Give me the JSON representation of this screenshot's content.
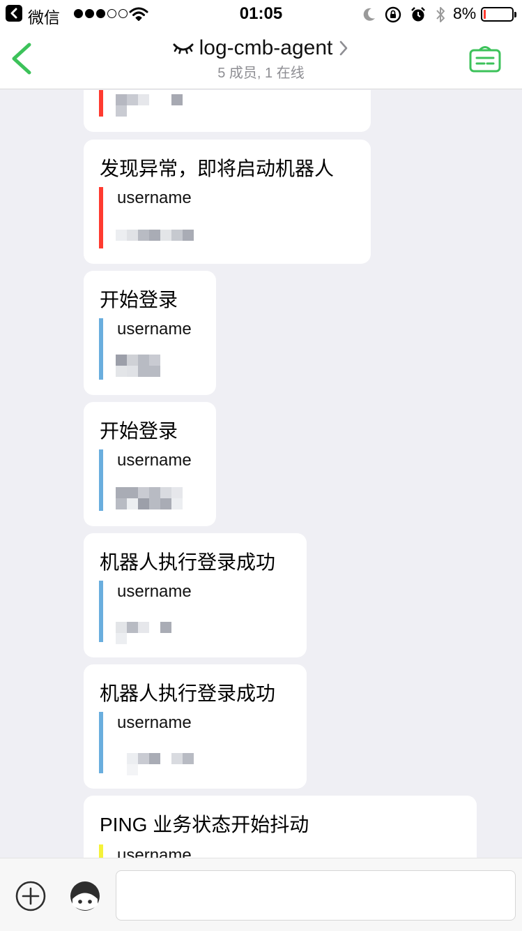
{
  "status_bar": {
    "carrier": "微信",
    "time": "01:05",
    "battery": "8%",
    "battery_level_percent": 8
  },
  "nav": {
    "title": "log-cmb-agent",
    "subtitle": "5 成员, 1 在线",
    "accent_color": "#3cc25a"
  },
  "messages": [
    {
      "title": "",
      "quote_user": "",
      "bar_color": "#ff3b30"
    },
    {
      "title": "发现异常，即将启动机器人",
      "quote_user": "username",
      "bar_color": "#ff3b30"
    },
    {
      "title": "开始登录",
      "quote_user": "username",
      "bar_color": "#6aaede"
    },
    {
      "title": "开始登录",
      "quote_user": "username",
      "bar_color": "#6aaede"
    },
    {
      "title": "机器人执行登录成功",
      "quote_user": "username",
      "bar_color": "#6aaede"
    },
    {
      "title": "机器人执行登录成功",
      "quote_user": "username",
      "bar_color": "#6aaede"
    },
    {
      "title": "PING 业务状态开始抖动",
      "quote_user": "username",
      "bar_color": "#f5f23a"
    }
  ],
  "input": {
    "value": "",
    "placeholder": ""
  },
  "icons": {
    "back": "chevron-left-icon",
    "wechat_back": "wechat-back-icon",
    "wifi": "wifi-icon",
    "moon": "moon-icon",
    "rotation_lock": "rotation-lock-icon",
    "alarm": "alarm-icon",
    "bluetooth": "bluetooth-icon",
    "group_eye": "closed-eye-icon",
    "chevron": "chevron-right-icon",
    "doc": "document-icon",
    "plus": "plus-icon",
    "face": "emoji-face-icon"
  }
}
